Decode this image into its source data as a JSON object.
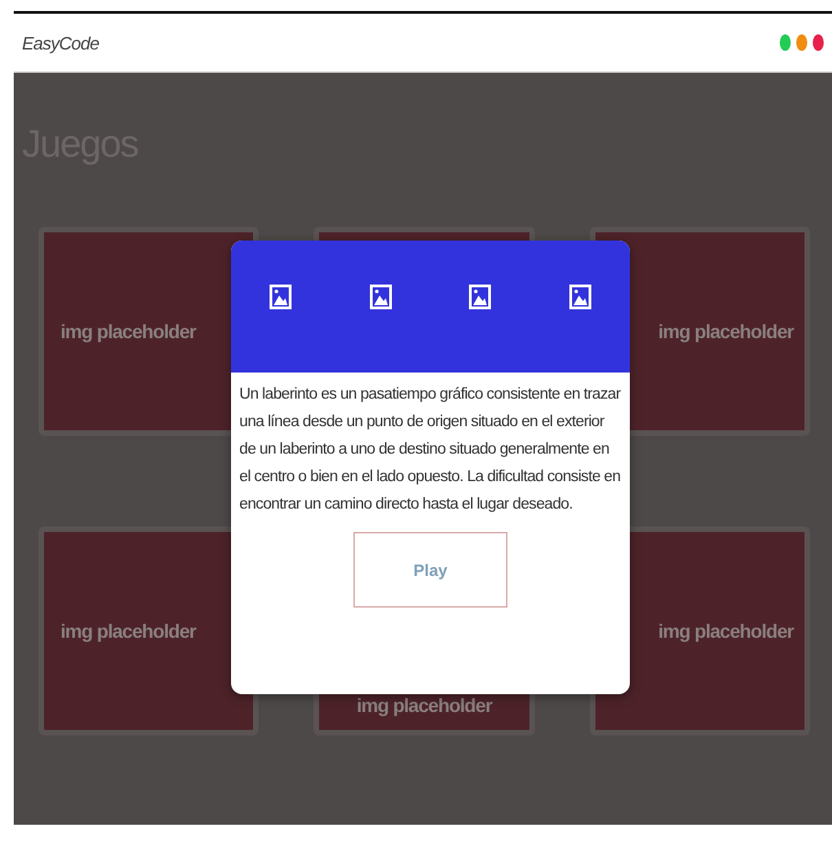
{
  "window": {
    "title": "EasyCode",
    "controls": [
      {
        "color": "#22cc55"
      },
      {
        "color": "#f08c10"
      },
      {
        "color": "#e8204a"
      }
    ]
  },
  "page_title": "Juegos",
  "cards": [
    {
      "kind": "image",
      "label": "img placeholder"
    },
    {
      "kind": "covered"
    },
    {
      "kind": "image",
      "label": "img placeholder"
    },
    {
      "kind": "image",
      "label": "img placeholder"
    },
    {
      "kind": "image",
      "label": "img placeholder"
    },
    {
      "kind": "image",
      "label": "img placeholder"
    }
  ],
  "dialog": {
    "description": "Un laberinto es un pasatiempo gráfico consistente en trazar una línea desde un punto de origen situado en el exterior de un laberinto a uno de destino situado generalmente en el centro o bien en el lado opuesto. La dificultad consiste en encontrar un camino directo hasta el lugar deseado.",
    "button": "Play"
  }
}
